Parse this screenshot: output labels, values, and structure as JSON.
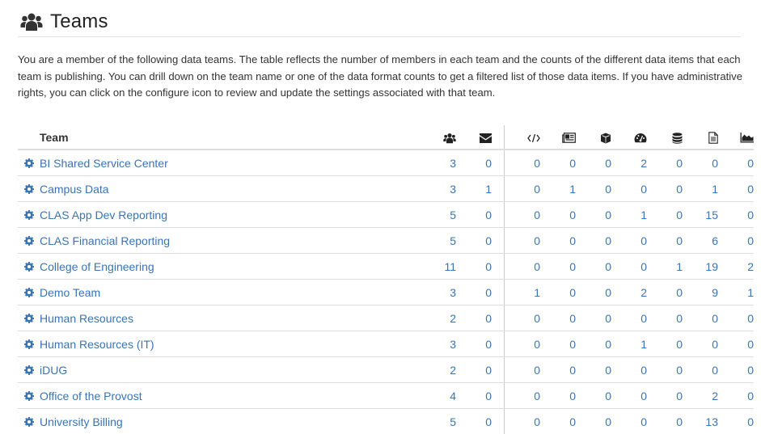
{
  "header": {
    "title": "Teams",
    "icon": "users-icon"
  },
  "intro": "You are a member of the following data teams. The table reflects the number of members in each team and the counts of the different data items that each team is publishing. You can drill down on the team name or one of the data format counts to get a filtered list of those data items. If you have administrative rights, you can click on the configure icon to review and update the settings associated with that team.",
  "table": {
    "columns": [
      {
        "key": "team",
        "label": "Team"
      },
      {
        "key": "members",
        "icon": "users-icon"
      },
      {
        "key": "messages",
        "icon": "envelope-icon"
      },
      {
        "key": "code",
        "icon": "code-icon"
      },
      {
        "key": "news",
        "icon": "newspaper-icon"
      },
      {
        "key": "cube",
        "icon": "cube-icon"
      },
      {
        "key": "dashboard",
        "icon": "dashboard-icon"
      },
      {
        "key": "database",
        "icon": "database-icon"
      },
      {
        "key": "document",
        "icon": "file-text-icon"
      },
      {
        "key": "chart",
        "icon": "area-chart-icon"
      }
    ],
    "colors": {
      "link": "#3a74b3",
      "icon": "#222222"
    },
    "rows": [
      {
        "team": "BI Shared Service Center",
        "values": [
          "3",
          "0",
          "0",
          "0",
          "0",
          "2",
          "0",
          "0",
          "0"
        ]
      },
      {
        "team": "Campus Data",
        "values": [
          "3",
          "1",
          "0",
          "1",
          "0",
          "0",
          "0",
          "1",
          "0"
        ]
      },
      {
        "team": "CLAS App Dev Reporting",
        "values": [
          "5",
          "0",
          "0",
          "0",
          "0",
          "1",
          "0",
          "15",
          "0"
        ]
      },
      {
        "team": "CLAS Financial Reporting",
        "values": [
          "5",
          "0",
          "0",
          "0",
          "0",
          "0",
          "0",
          "6",
          "0"
        ]
      },
      {
        "team": "College of Engineering",
        "values": [
          "11",
          "0",
          "0",
          "0",
          "0",
          "0",
          "1",
          "19",
          "2"
        ]
      },
      {
        "team": "Demo Team",
        "values": [
          "3",
          "0",
          "1",
          "0",
          "0",
          "2",
          "0",
          "9",
          "1"
        ]
      },
      {
        "team": "Human Resources",
        "values": [
          "2",
          "0",
          "0",
          "0",
          "0",
          "0",
          "0",
          "0",
          "0"
        ]
      },
      {
        "team": "Human Resources (IT)",
        "values": [
          "3",
          "0",
          "0",
          "0",
          "0",
          "1",
          "0",
          "0",
          "0"
        ]
      },
      {
        "team": "iDUG",
        "values": [
          "2",
          "0",
          "0",
          "0",
          "0",
          "0",
          "0",
          "0",
          "0"
        ]
      },
      {
        "team": "Office of the Provost",
        "values": [
          "4",
          "0",
          "0",
          "0",
          "0",
          "0",
          "0",
          "2",
          "0"
        ]
      },
      {
        "team": "University Billing",
        "values": [
          "5",
          "0",
          "0",
          "0",
          "0",
          "0",
          "0",
          "13",
          "0"
        ]
      }
    ]
  }
}
